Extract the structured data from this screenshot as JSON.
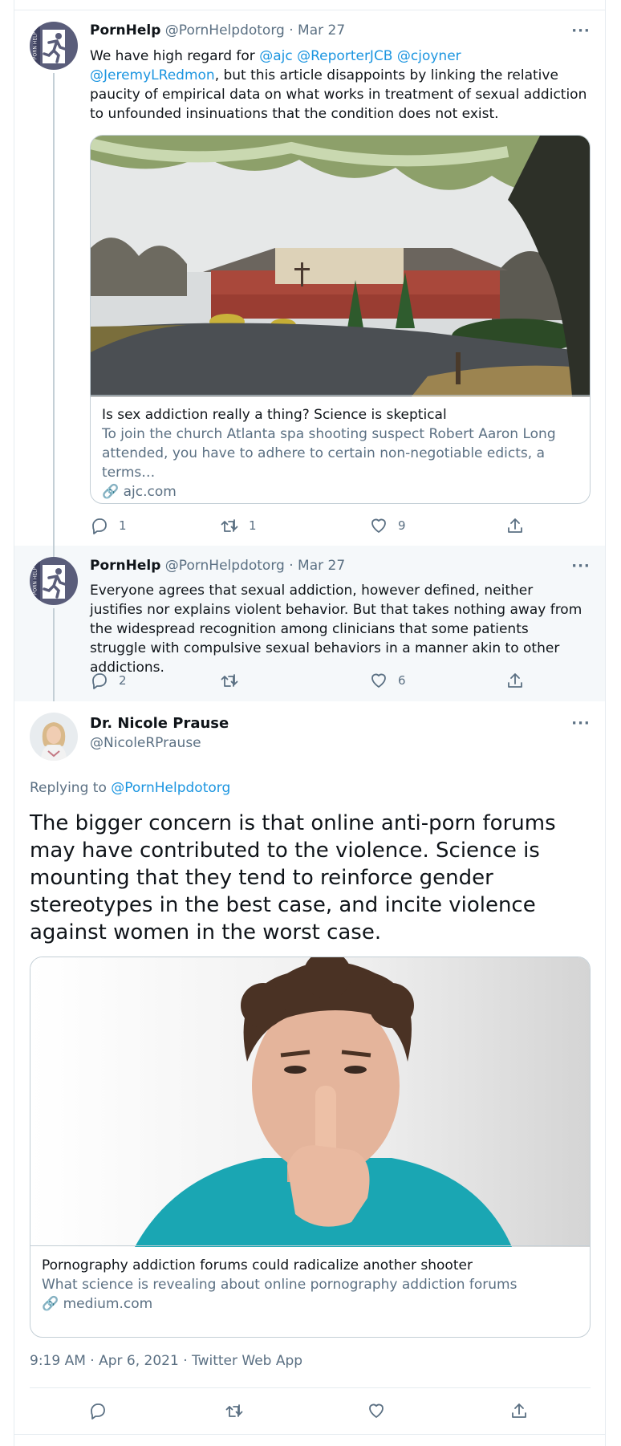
{
  "tweets": [
    {
      "name": "PornHelp",
      "handle": "@PornHelpdotorg",
      "date": "Mar 27",
      "avatar_icon": "running-figure-logo-icon",
      "text_before": "We have high regard for ",
      "mentions": [
        "@ajc",
        "@ReporterJCB",
        "@cjoyner",
        "@JeremyLRedmon"
      ],
      "text_after": ", but this article disappoints by linking the relative paucity of empirical data on what works in treatment of sexual addiction to unfounded insinuations that the condition does not exist.",
      "card": {
        "title": "Is sex addiction really a thing? Science is skeptical",
        "description": "To join the church Atlanta spa shooting suspect Robert Aaron Long attended, you have to adhere to certain non-negotiable edicts, a terms…",
        "domain": "ajc.com"
      },
      "replies": "1",
      "retweets": "1",
      "likes": "9"
    },
    {
      "name": "PornHelp",
      "handle": "@PornHelpdotorg",
      "date": "Mar 27",
      "text": "Everyone agrees that sexual addiction, however defined, neither justifies nor explains violent behavior. But that takes nothing away from the widespread recognition among clinicians that some patients struggle with compulsive sexual behaviors in a manner akin to other addictions.",
      "replies": "2",
      "retweets": "",
      "likes": "6"
    }
  ],
  "main": {
    "name": "Dr. Nicole Prause",
    "handle": "@NicoleRPrause",
    "replying_label": "Replying to ",
    "replying_to": "@PornHelpdotorg",
    "text": "The bigger concern is that online anti-porn forums may have contributed to the violence. Science is mounting that they tend to reinforce gender stereotypes in the best case, and incite violence against women in the worst case.",
    "card": {
      "title": "Pornography addiction forums could radicalize another shooter",
      "description": "What science is revealing about online pornography addiction forums",
      "domain": "medium.com"
    },
    "timestamp": "9:19 AM · Apr 6, 2021 · Twitter Web App"
  },
  "colors": {
    "link": "#1b95e0",
    "secondary_text": "#5b7083",
    "border": "#e6ecf0",
    "hover_bg": "#f5f8fa"
  }
}
